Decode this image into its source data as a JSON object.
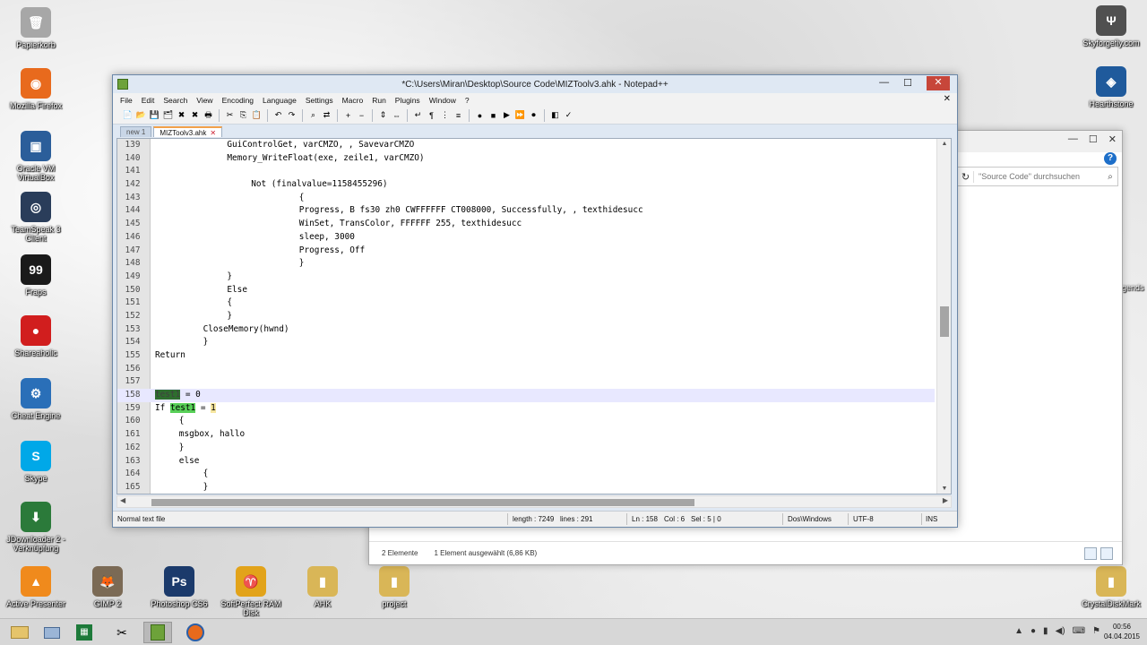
{
  "desktop": {
    "left_icons": [
      {
        "label": "Papierkorb",
        "icon": "recycle-bin-icon",
        "color": "#a7a7a7",
        "glyph": "🗑"
      },
      {
        "label": "Mozilla Firefox",
        "icon": "firefox-icon",
        "color": "#e86a1d",
        "glyph": "◉"
      },
      {
        "label": "Oracle VM VirtualBox",
        "icon": "virtualbox-icon",
        "color": "#2b5e9a",
        "glyph": "▣"
      },
      {
        "label": "TeamSpeak 3 Client",
        "icon": "teamspeak-icon",
        "color": "#2a3d5a",
        "glyph": "◎"
      },
      {
        "label": "Fraps",
        "icon": "fraps-icon",
        "color": "#1a1a1a",
        "glyph": "99"
      },
      {
        "label": "Shareaholic",
        "icon": "shareaholic-icon",
        "color": "#d11e1e",
        "glyph": "●"
      },
      {
        "label": "Cheat Engine",
        "icon": "cheat-engine-icon",
        "color": "#2a6fb8",
        "glyph": "⚙"
      },
      {
        "label": "Skype",
        "icon": "skype-icon",
        "color": "#00a8e8",
        "glyph": "S"
      },
      {
        "label": "JDownloader 2 -\nVerknüpfung",
        "icon": "jdownloader-icon",
        "color": "#2b7a3a",
        "glyph": "⬇"
      },
      {
        "label": "Active Presenter",
        "icon": "activepresenter-icon",
        "color": "#f08a1c",
        "glyph": "▲"
      }
    ],
    "bottom_icons": [
      {
        "label": "GIMP 2",
        "icon": "gimp-icon",
        "color": "#7b6a55",
        "glyph": "🦊"
      },
      {
        "label": "Photoshop CS6",
        "icon": "photoshop-icon",
        "color": "#1b3a6b",
        "glyph": "Ps"
      },
      {
        "label": "SoftPerfect RAM Disk",
        "icon": "ramdisk-icon",
        "color": "#e2a31a",
        "glyph": "♈"
      },
      {
        "label": "AHK",
        "icon": "folder-icon",
        "color": "#d9b657",
        "glyph": "▮"
      },
      {
        "label": "project",
        "icon": "folder-icon",
        "color": "#d9b657",
        "glyph": "▮"
      }
    ],
    "right_icons": [
      {
        "label": "Skyforgefly.com",
        "icon": "skyforge-icon",
        "color": "#505050",
        "glyph": "Ψ"
      },
      {
        "label": "Hearthstone",
        "icon": "hearthstone-icon",
        "color": "#1f5a9c",
        "glyph": "◈"
      },
      {
        "label": "CrystalDiskMark",
        "icon": "folder-icon",
        "color": "#d9b657",
        "glyph": "▮"
      }
    ],
    "right_partial_label": "gends"
  },
  "explorer": {
    "search_placeholder": "\"Source Code\" durchsuchen",
    "item_count": "2 Elemente",
    "selection": "1 Element ausgewählt (6,86 KB)"
  },
  "npp": {
    "title": "*C:\\Users\\Miran\\Desktop\\Source Code\\MIZToolv3.ahk - Notepad++",
    "menu": [
      "File",
      "Edit",
      "Search",
      "View",
      "Encoding",
      "Language",
      "Settings",
      "Macro",
      "Run",
      "Plugins",
      "Window",
      "?"
    ],
    "tabs": [
      {
        "label": "new 1",
        "active": false
      },
      {
        "label": "MIZToolv3.ahk",
        "active": true
      }
    ],
    "code_lines": [
      {
        "n": "139",
        "indent": 6,
        "text": "GuiControlGet, varCMZO, , SavevarCMZO"
      },
      {
        "n": "140",
        "indent": 6,
        "text": "Memory_WriteFloat(exe, zeile1, varCMZO)"
      },
      {
        "n": "141",
        "indent": 6,
        "text": ""
      },
      {
        "n": "142",
        "indent": 8,
        "text": "Not (finalvalue=1158455296)"
      },
      {
        "n": "143",
        "indent": 12,
        "text": "{"
      },
      {
        "n": "144",
        "indent": 12,
        "text": "Progress, B fs30 zh0 CWFFFFFF CT008000, Successfully, , texthidesucc"
      },
      {
        "n": "145",
        "indent": 12,
        "text": "WinSet, TransColor, FFFFFF 255, texthidesucc"
      },
      {
        "n": "146",
        "indent": 12,
        "text": "sleep, 3000"
      },
      {
        "n": "147",
        "indent": 12,
        "text": "Progress, Off"
      },
      {
        "n": "148",
        "indent": 12,
        "text": "}"
      },
      {
        "n": "149",
        "indent": 6,
        "text": "}"
      },
      {
        "n": "150",
        "indent": 6,
        "text": "Else"
      },
      {
        "n": "151",
        "indent": 6,
        "text": "{"
      },
      {
        "n": "152",
        "indent": 6,
        "text": "}"
      },
      {
        "n": "153",
        "indent": 4,
        "text": "CloseMemory(hwnd)"
      },
      {
        "n": "154",
        "indent": 4,
        "text": "}"
      },
      {
        "n": "155",
        "indent": 0,
        "text": "Return"
      },
      {
        "n": "156",
        "indent": 0,
        "text": ""
      },
      {
        "n": "157",
        "indent": 0,
        "text": ""
      },
      {
        "n": "158",
        "indent": 0,
        "text": "test1 = 0"
      },
      {
        "n": "159",
        "indent": 0,
        "text": "If test1 = 1"
      },
      {
        "n": "160",
        "indent": 2,
        "text": "{"
      },
      {
        "n": "161",
        "indent": 2,
        "text": "msgbox, hallo"
      },
      {
        "n": "162",
        "indent": 2,
        "text": "}"
      },
      {
        "n": "163",
        "indent": 2,
        "text": "else"
      },
      {
        "n": "164",
        "indent": 4,
        "text": "{"
      },
      {
        "n": "165",
        "indent": 4,
        "text": "}"
      }
    ],
    "status": {
      "filetype": "Normal text file",
      "length": "length : 7249",
      "lines": "lines : 291",
      "ln": "Ln : 158",
      "col": "Col : 6",
      "sel": "Sel : 5 | 0",
      "eol": "Dos\\Windows",
      "encoding": "UTF-8",
      "mode": "INS"
    }
  },
  "taskbar": {
    "time": "00:56",
    "date": "04.04.2015"
  },
  "colors": {
    "selection": "#2e6e2e",
    "highlight": "#58d058",
    "current_line": "#e8e8ff",
    "tab_accent": "#f2a14a"
  }
}
